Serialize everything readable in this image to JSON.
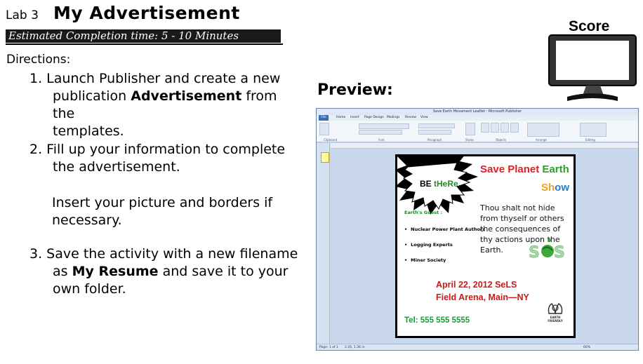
{
  "header": {
    "lab_label": "Lab 3",
    "title": "My Advertisement",
    "estimate": "Estimated Completion time: 5 - 10 Minutes"
  },
  "directions": {
    "label": "Directions:",
    "step1_pre": "1.  Launch Publisher and create a new",
    "step1_line2_pre": "publication ",
    "step1_bold": "Advertisement",
    "step1_line2_post": " from the",
    "step1_line3": "templates.",
    "step2_line1": "2.  Fill up your information to complete",
    "step2_line2": "the advertisement.",
    "step2b_line1": "Insert your picture and borders if",
    "step2b_line2": "necessary.",
    "step3_line1": "3.  Save the activity with a new filename",
    "step3_pre": "as ",
    "step3_bold1": "My Resume",
    "step3_post": " and save it to your",
    "step3_line3": "own folder."
  },
  "score": {
    "label": "Score"
  },
  "preview": {
    "label": "Preview:"
  },
  "publisher": {
    "window_title": "Save Earth Movement Leaflet - Microsoft Publisher",
    "file_tab": "File",
    "tabs": [
      "Home",
      "Insert",
      "Page Design",
      "Mailings",
      "Review",
      "View"
    ],
    "groups": [
      "Clipboard",
      "Font",
      "Paragraph",
      "Styles",
      "Objects",
      "Arrange",
      "Editing"
    ],
    "status_left": "Page: 1 of 1",
    "status_pos": "2.20, 1.36 in.",
    "zoom": "66%"
  },
  "document": {
    "be_text": "BE ",
    "be_here": "tHeRe",
    "title_part1": "Save Planet ",
    "title_part2": "Earth",
    "title_show_1": "Sh",
    "title_show_2": "ow",
    "guest_label": "Earth's Guest :",
    "guests": [
      "Nuclear Power Plant Authors",
      "Logging Experts",
      "Miner Society"
    ],
    "quote": "Thou shalt not hide from thyself or others the consequences of thy actions upon the Earth.",
    "date": "April 22, 2012 SeLS",
    "venue": "Field Arena, Main—NY",
    "tel": "Tel: 555 555 5555",
    "logo_text_1": "EARTH",
    "logo_text_2": "FRIENDLY"
  },
  "colors": {
    "red": "#d01818",
    "green": "#1a9a3a",
    "orange": "#f4a020",
    "blue": "#2a7ad0"
  }
}
